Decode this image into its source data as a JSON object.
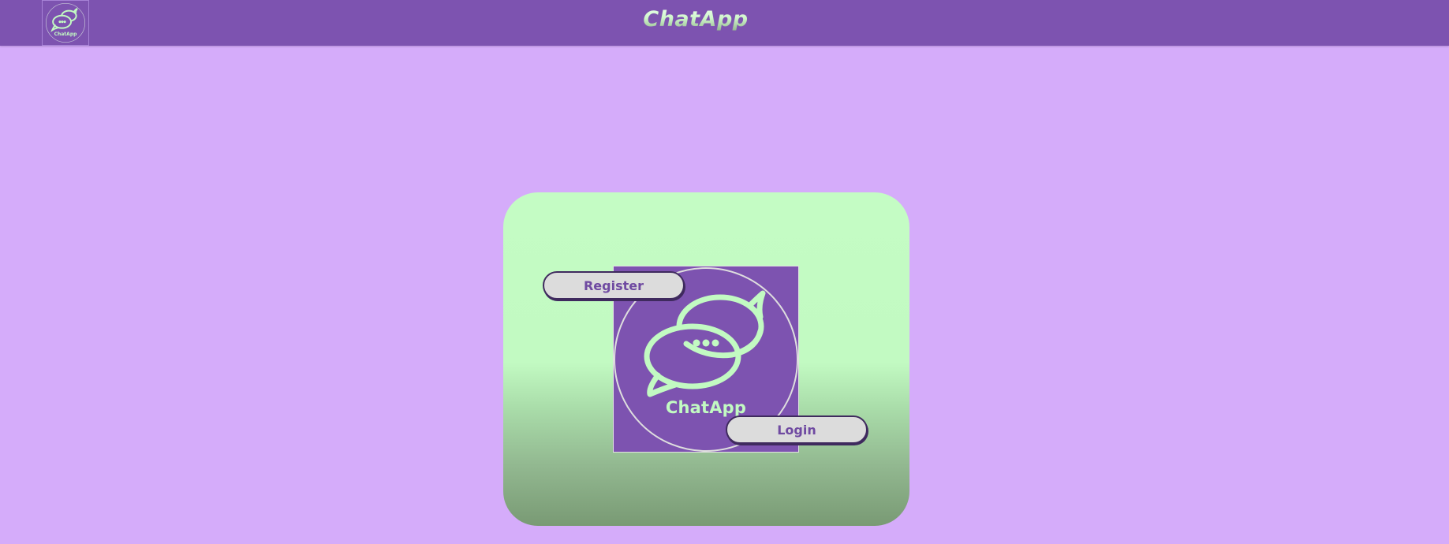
{
  "header": {
    "title": "ChatApp",
    "logo_text": "ChatApp",
    "logo_icon": "chat-bubbles-icon"
  },
  "card": {
    "logo_text": "ChatApp",
    "logo_icon": "chat-bubbles-icon",
    "register_label": "Register",
    "login_label": "Login"
  },
  "colors": {
    "page_background": "#d5acfa",
    "header_background": "#7d53b0",
    "accent_green": "#c2fac2",
    "button_background": "#dcdcdc",
    "button_text": "#6f4aa1"
  }
}
